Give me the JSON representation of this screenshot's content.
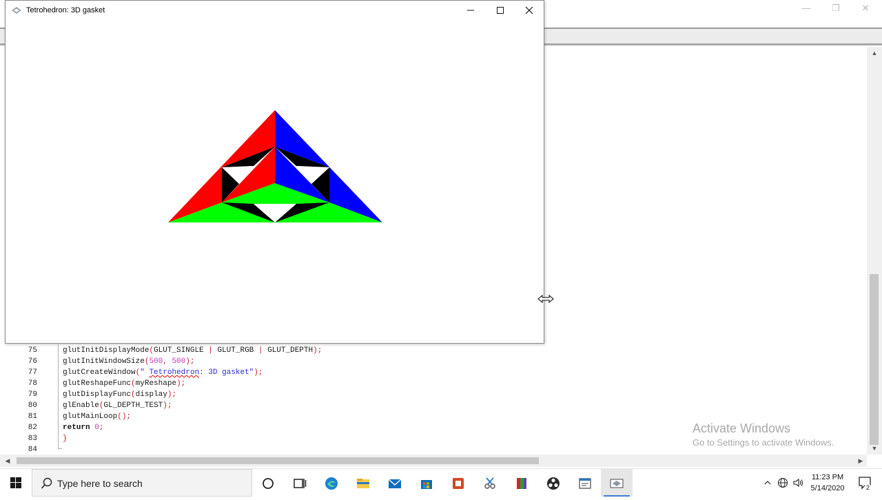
{
  "ide": {
    "controls": {
      "minimize": "—",
      "restore": "❐",
      "close": "✕"
    },
    "code_lines": [
      {
        "num": "75",
        "tokens": [
          {
            "t": "glutInitDisplayMode",
            "c": "fn"
          },
          {
            "t": "(",
            "c": "p"
          },
          {
            "t": "GLUT_SINGLE ",
            "c": "fn"
          },
          {
            "t": "|",
            "c": "p"
          },
          {
            "t": " GLUT_RGB ",
            "c": "fn"
          },
          {
            "t": "|",
            "c": "p"
          },
          {
            "t": " GLUT_DEPTH",
            "c": "fn"
          },
          {
            "t": ");",
            "c": "p"
          }
        ]
      },
      {
        "num": "76",
        "tokens": [
          {
            "t": "glutInitWindowSize",
            "c": "fn"
          },
          {
            "t": "(",
            "c": "p"
          },
          {
            "t": "500",
            "c": "num"
          },
          {
            "t": ", ",
            "c": "p"
          },
          {
            "t": "500",
            "c": "num"
          },
          {
            "t": ");",
            "c": "p"
          }
        ]
      },
      {
        "num": "77",
        "tokens": [
          {
            "t": "glutCreateWindow",
            "c": "fn"
          },
          {
            "t": "(",
            "c": "p"
          },
          {
            "t": "\" ",
            "c": "str"
          },
          {
            "t": "Tetrohedron",
            "c": "str sq"
          },
          {
            "t": ": 3D gasket\"",
            "c": "str"
          },
          {
            "t": ");",
            "c": "p"
          }
        ]
      },
      {
        "num": "78",
        "tokens": [
          {
            "t": "glutReshapeFunc",
            "c": "fn"
          },
          {
            "t": "(",
            "c": "p"
          },
          {
            "t": "myReshape",
            "c": "fn"
          },
          {
            "t": ");",
            "c": "p"
          }
        ]
      },
      {
        "num": "79",
        "tokens": [
          {
            "t": "glutDisplayFunc",
            "c": "fn"
          },
          {
            "t": "(",
            "c": "p"
          },
          {
            "t": "display",
            "c": "fn"
          },
          {
            "t": ");",
            "c": "p"
          }
        ]
      },
      {
        "num": "80",
        "tokens": [
          {
            "t": "glEnable",
            "c": "fn"
          },
          {
            "t": "(",
            "c": "p"
          },
          {
            "t": "GL_DEPTH_TEST",
            "c": "fn"
          },
          {
            "t": ");",
            "c": "p"
          }
        ]
      },
      {
        "num": "81",
        "tokens": [
          {
            "t": "glutMainLoop",
            "c": "fn"
          },
          {
            "t": "();",
            "c": "p"
          }
        ]
      },
      {
        "num": "82",
        "tokens": [
          {
            "t": "return",
            "c": "kw"
          },
          {
            "t": " ",
            "c": "fn"
          },
          {
            "t": "0",
            "c": "num"
          },
          {
            "t": ";",
            "c": "p"
          }
        ]
      },
      {
        "num": "83",
        "tokens": [
          {
            "t": "}",
            "c": "p"
          }
        ]
      },
      {
        "num": "84",
        "tokens": []
      }
    ],
    "watermark": {
      "line1": "Activate Windows",
      "line2": "Go to Settings to activate Windows."
    }
  },
  "glut_window": {
    "title": "Tetrohedron: 3D gasket",
    "controls": {
      "minimize": "—",
      "maximize": "☐",
      "close": "✕"
    },
    "colors": {
      "red": "#ff0000",
      "blue": "#0000ff",
      "green": "#00ff00",
      "black": "#000000",
      "background": "#ffffff"
    }
  },
  "taskbar": {
    "search_placeholder": "Type here to search",
    "time": "11:23 PM",
    "date": "5/14/2020",
    "notification_count": "2",
    "apps": [
      "cortana-icon",
      "task-view-icon",
      "edge-icon",
      "file-explorer-icon",
      "mail-icon",
      "store-icon",
      "office-icon",
      "snipping-icon",
      "winrar-icon",
      "obs-icon",
      "codeblocks-icon",
      "glut-app-icon"
    ]
  }
}
